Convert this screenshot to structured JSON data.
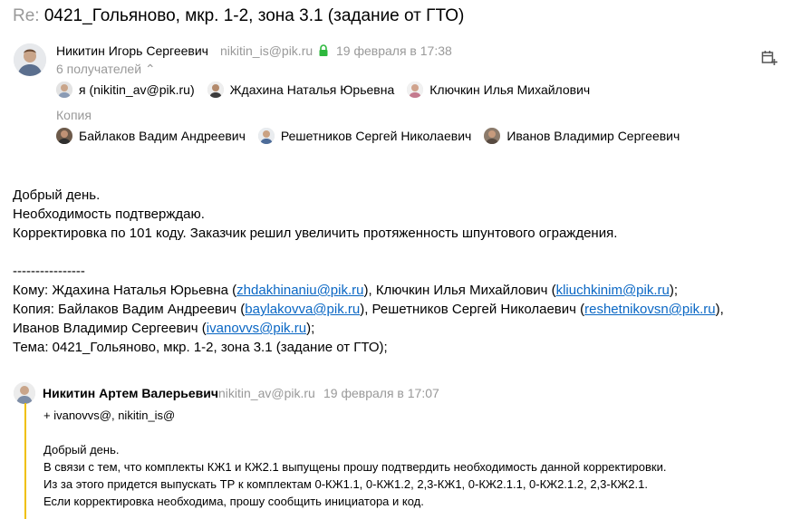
{
  "subject": {
    "prefix": "Re:",
    "title": "0421_Гольяново, мкр. 1-2, зона 3.1 (задание от ГТО)"
  },
  "sender": {
    "name": "Никитин Игорь Сергеевич",
    "email": "nikitin_is@pik.ru",
    "date": "19 февраля в 17:38",
    "recipients_count": "6 получателей ⌃"
  },
  "to": [
    {
      "label": "я (nikitin_av@pik.ru)"
    },
    {
      "label": "Ждахина Наталья Юрьевна"
    },
    {
      "label": "Ключкин Илья Михайлович"
    }
  ],
  "copy_label": "Копия",
  "cc": [
    {
      "label": "Байлаков Вадим Андреевич"
    },
    {
      "label": "Решетников Сергей Николаевич"
    },
    {
      "label": "Иванов Владимир Сергеевич"
    }
  ],
  "body": {
    "greeting": "Добрый день.",
    "line2": "Необходимость подтверждаю.",
    "line3": "Корректировка по 101 коду. Заказчик решил увеличить протяженность шпунтового ограждения.",
    "separator": "----------------",
    "to_prefix": "Кому: Ждахина Наталья Юрьевна (",
    "to_email1": "zhdakhinaniu@pik.ru",
    "to_mid": "), Ключкин Илья Михайлович (",
    "to_email2": "kliuchkinim@pik.ru",
    "to_end": ");",
    "cc_prefix": "Копия: Байлаков Вадим Андреевич (",
    "cc_email1": "baylakovva@pik.ru",
    "cc_mid": "), Решетников Сергей Николаевич (",
    "cc_email2": "reshetnikovsn@pik.ru",
    "cc_end": "),",
    "cc2_prefix": "Иванов Владимир Сергеевич (",
    "cc2_email": "ivanovvs@pik.ru",
    "cc2_end": ");",
    "subject_line": "Тема: 0421_Гольяново, мкр. 1-2, зона 3.1 (задание от ГТО);"
  },
  "quoted": {
    "name": "Никитин Артем Валерьевич",
    "email": "nikitin_av@pik.ru",
    "date": "19 февраля в 17:07",
    "line1": "+ ivanovvs@, nikitin_is@",
    "line2": "Добрый день.",
    "line3": "В связи с тем, что комплекты КЖ1 и КЖ2.1 выпущены прошу подтвердить необходимость данной корректировки.",
    "line4": "Из за этого придется выпускать ТР к комплектам 0-КЖ1.1,  0-КЖ1.2,   2,3-КЖ1,  0-КЖ2.1.1,  0-КЖ2.1.2,  2,3-КЖ2.1.",
    "line5": "Если корректировка необходима, прошу сообщить инициатора и код."
  },
  "colors": {
    "accent_yellow": "#f0c000",
    "link": "#0a67c4",
    "muted": "#999999",
    "lock_green": "#2db83d"
  },
  "icons": [
    "avatar",
    "lock-icon",
    "calendar-add-icon",
    "chevron-up-icon"
  ]
}
